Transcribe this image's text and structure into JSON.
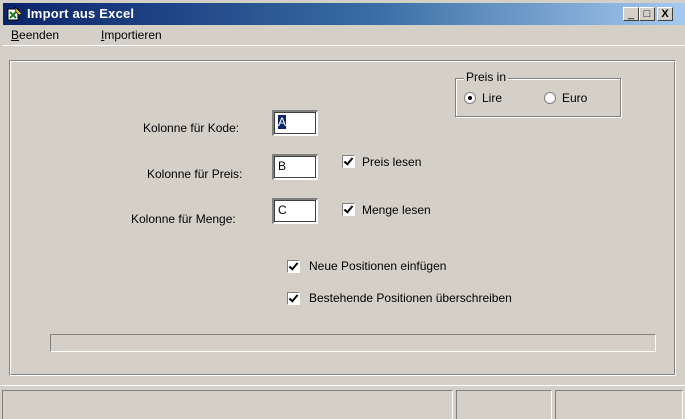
{
  "window": {
    "title": "Import aus Excel",
    "controls": {
      "minimize": "_",
      "maximize": "□",
      "close": "X"
    }
  },
  "menu": {
    "items": [
      {
        "accel": "B",
        "rest": "eenden"
      },
      {
        "accel": "I",
        "rest": "mportieren"
      }
    ]
  },
  "form": {
    "kode_label": "Kolonne für Kode:",
    "kode_value": "A",
    "preis_label": "Kolonne für Preis:",
    "preis_value": "B",
    "menge_label": "Kolonne für Menge:",
    "menge_value": "C",
    "preis_lesen": {
      "label": "Preis lesen",
      "checked": true
    },
    "menge_lesen": {
      "label": "Menge lesen",
      "checked": true
    },
    "neue_positionen": {
      "label": "Neue Positionen einfügen",
      "checked": true
    },
    "bestehende_positionen": {
      "label": "Bestehende Positionen überschreiben",
      "checked": true
    }
  },
  "currency_group": {
    "title": "Preis in",
    "options": [
      {
        "label": "Lire",
        "selected": true
      },
      {
        "label": "Euro",
        "selected": false
      }
    ]
  },
  "progress": {
    "fraction": 0
  },
  "status": {
    "panes": [
      "",
      "",
      ""
    ]
  },
  "colors": {
    "titlebar_start": "#0a246a",
    "titlebar_end": "#a6caf0",
    "face": "#d4d0c8"
  },
  "icons": {
    "app": "excel-import-icon"
  }
}
